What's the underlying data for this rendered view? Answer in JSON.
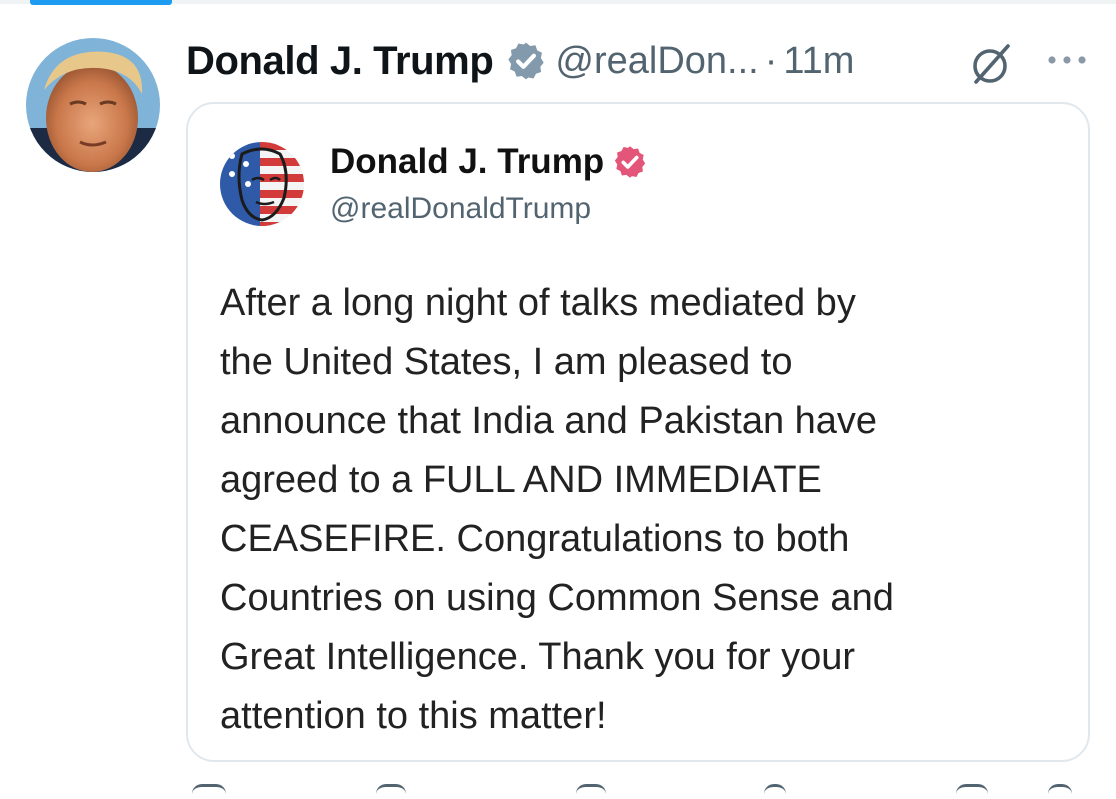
{
  "tweet": {
    "author": {
      "display_name": "Donald J. Trump",
      "handle": "@realDon...",
      "avatar_icon": "profile-photo-icon"
    },
    "separator": "·",
    "time": "11m",
    "header_icons": [
      "verified-badge-icon",
      "grok-icon",
      "more-options-icon"
    ]
  },
  "quoted_post": {
    "author": {
      "display_name": "Donald J. Trump",
      "handle": "@realDonaldTrump",
      "avatar_icon": "flag-portrait-avatar-icon",
      "badge_icon": "verified-badge-icon"
    },
    "lines": [
      "After a long night of talks mediated by",
      "the United States, I am pleased to",
      "announce that India and Pakistan have",
      "agreed to a FULL AND IMMEDIATE",
      "CEASEFIRE. Congratulations to both",
      "Countries on using Common Sense and",
      "Great Intelligence. Thank you for your",
      "attention to this matter!"
    ]
  },
  "colors": {
    "accent": "#1d9bf0",
    "verified_badge": "#829aab",
    "quoted_badge": "#e4557a",
    "secondary_text": "#536471",
    "card_border": "#e1e8ed"
  }
}
